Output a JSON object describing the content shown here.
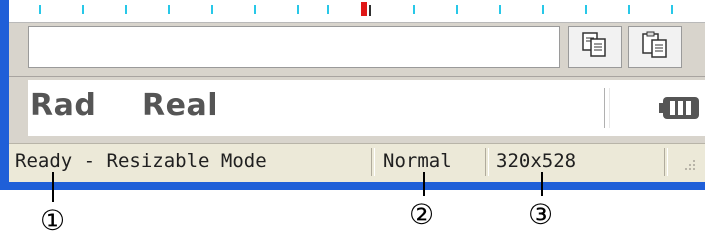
{
  "angle_mode": "Rad",
  "number_mode": "Real",
  "status_bar": {
    "message": "Ready - Resizable Mode",
    "size_mode": "Normal",
    "dimensions": "320x528"
  },
  "toolbar": {
    "copy_icon": "copy-icon",
    "paste_icon": "paste-icon"
  },
  "callouts": [
    "①",
    "②",
    "③"
  ],
  "colors": {
    "window_frame": "#1f5fd8",
    "ruler_tick": "#28c8e8",
    "cursor_mark": "#e01818",
    "status_bar_bg": "#ece9d8"
  }
}
